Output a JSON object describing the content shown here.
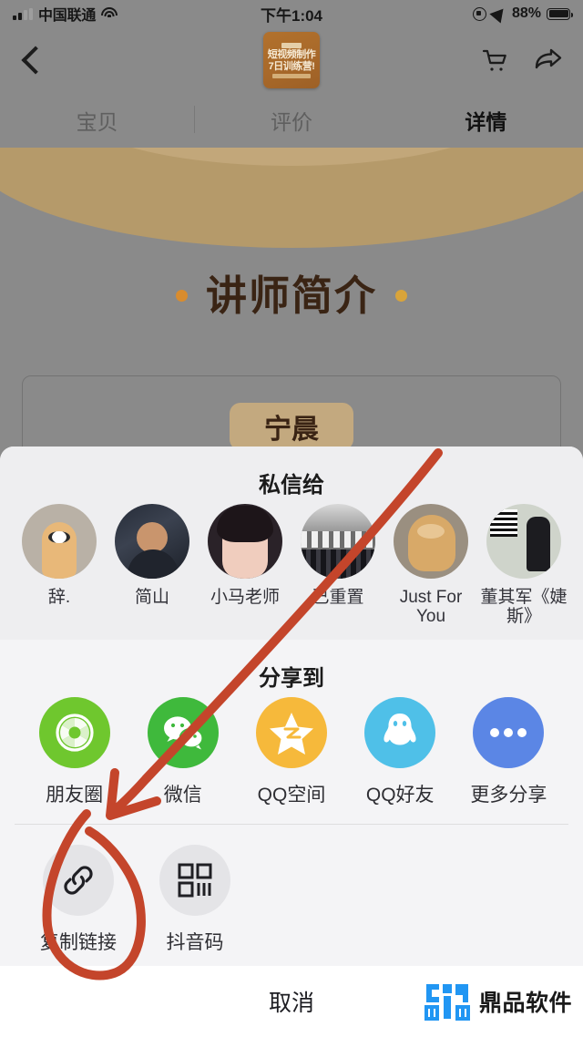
{
  "status_bar": {
    "carrier": "中国联通",
    "time": "下午1:04",
    "battery_percent": "88%",
    "icons": [
      "signal-icon",
      "wifi-icon",
      "rotation-lock-icon",
      "location-arrow-icon",
      "battery-icon"
    ]
  },
  "nav": {
    "back_icon": "back-chevron-icon",
    "cart_icon": "shopping-cart-icon",
    "share_icon": "share-arrow-icon",
    "product_thumb": {
      "line1": "短视频制作",
      "line2": "7日训练营!",
      "bg_color": "#a8692a"
    }
  },
  "tabs": [
    {
      "label": "宝贝",
      "active": false
    },
    {
      "label": "评价",
      "active": false
    },
    {
      "label": "详情",
      "active": true
    }
  ],
  "detail": {
    "section_title": "讲师简介",
    "instructor_name": "宁晨"
  },
  "sheet": {
    "private_message": {
      "heading": "私信给",
      "contacts": [
        {
          "name": "辞.",
          "avatar": "cartoon-avatar"
        },
        {
          "name": "简山",
          "avatar": "man-glasses-avatar"
        },
        {
          "name": "小马老师",
          "avatar": "woman-selfie-avatar"
        },
        {
          "name": "已重置",
          "avatar": "group-photo-avatar"
        },
        {
          "name": "Just For You",
          "avatar": "cat-avatar"
        },
        {
          "name": "董其军《婕斯》",
          "avatar": "qrcode-person-avatar"
        }
      ]
    },
    "share_to": {
      "heading": "分享到",
      "targets": [
        {
          "name": "朋友圈",
          "icon": "moments-aperture-icon",
          "color": "#6fc72e"
        },
        {
          "name": "微信",
          "icon": "wechat-icon",
          "color": "#3fb93c"
        },
        {
          "name": "QQ空间",
          "icon": "qzone-star-icon",
          "color": "#f6b93b"
        },
        {
          "name": "QQ好友",
          "icon": "qq-penguin-icon",
          "color": "#4fc0e8"
        },
        {
          "name": "更多分享",
          "icon": "more-dots-icon",
          "color": "#5b86e5"
        }
      ]
    },
    "bottom_actions": [
      {
        "name": "复制链接",
        "icon": "link-chain-icon"
      },
      {
        "name": "抖音码",
        "icon": "qr-code-icon"
      }
    ],
    "cancel_label": "取消"
  },
  "watermark": {
    "text": "鼎品软件",
    "logo_color": "#2196f3"
  },
  "annotations": {
    "color": "#c4452b",
    "marks": [
      "arrow-to-copy-link",
      "circle-around-copy-link"
    ]
  }
}
